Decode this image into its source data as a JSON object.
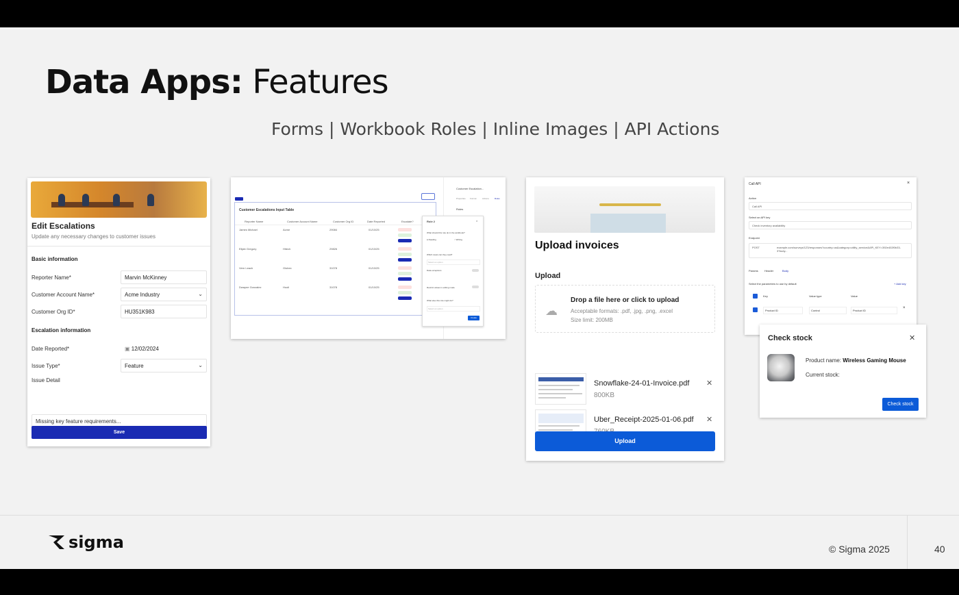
{
  "slide": {
    "title_bold": "Data Apps:",
    "title_light": "Features",
    "subtitle": "Forms | Workbook Roles | Inline Images | API Actions",
    "logo_text": "sigma",
    "copyright": "© Sigma 2025",
    "page_number": "40"
  },
  "form_card": {
    "title": "Edit Escalations",
    "subtitle": "Update any necessary changes to customer issues",
    "section_basic": "Basic information",
    "reporter_label": "Reporter Name*",
    "reporter_value": "Marvin McKinney",
    "account_label": "Customer Account Name*",
    "account_value": "Acme Industry",
    "org_label": "Customer Org ID*",
    "org_value": "HU351K983",
    "section_escalation": "Escalation information",
    "date_label": "Date Reported*",
    "date_value": "12/02/2024",
    "issue_type_label": "Issue Type*",
    "issue_type_value": "Feature",
    "issue_detail_label": "Issue Detail",
    "issue_detail_value": "Missing key feature requirements...",
    "save_label": "Save"
  },
  "table_card": {
    "table_title": "Customer Escalations Input Table",
    "columns": [
      "Reporter Name",
      "Customer Account Name",
      "Customer Org ID",
      "Date Reported",
      "Escalate?"
    ],
    "rows": [
      [
        "James Michael",
        "Acme",
        "29084",
        "01/10/25"
      ],
      [
        "Elijah Gregory",
        "Hitech",
        "29826",
        "01/10/25"
      ],
      [
        "Vern Leach",
        "Globex",
        "31078",
        "01/10/25"
      ],
      [
        "Dwayne Gonzalez",
        "Hooli",
        "31078",
        "01/10/25"
      ]
    ],
    "panel_title": "Role 2",
    "panel_items": [
      "What should this role do in the workbook?",
      "Reading",
      "Writing",
      "Which views can they read?",
      "Select an option",
      "Data exceptions",
      "Restrict values in editing mode",
      "What else this role might do?",
      "Select an option"
    ],
    "panel_button": "Create",
    "side_title": "Customer Escalation...",
    "side_tabs": [
      "Properties",
      "Format",
      "Actions",
      "Roles"
    ],
    "side_section": "Roles"
  },
  "upload_card": {
    "title": "Upload invoices",
    "section": "Upload",
    "drop_title": "Drop a file here or click to upload",
    "drop_formats": "Acceptable formats: .pdf, .jpg, .png, .excel",
    "drop_size": "Size limit: 200MB",
    "files": [
      {
        "name": "Snowflake-24-01-Invoice.pdf",
        "size": "800KB"
      },
      {
        "name": "Uber_Receipt-2025-01-06.pdf",
        "size": "760KB"
      }
    ],
    "upload_label": "Upload"
  },
  "api_card": {
    "title": "Call API",
    "action_label": "Action",
    "action_value": "Call API",
    "api_key_label": "Select an API key",
    "api_key_value": "Check inventory availability",
    "endpoint_label": "Endpoint",
    "method": "POST",
    "endpoint_value": "example.com/surveys/123/responses?country=us&category=utility_service&API_KEY=392e402f0b33-3*body...",
    "tabs": [
      "Params",
      "Header",
      "Body"
    ],
    "param_hint": "Select the parameters to use by default",
    "add_key": "+ Add key",
    "cols": [
      "Key",
      "Value type",
      "Value"
    ],
    "row": [
      "Product ID",
      "Control",
      "Product ID"
    ]
  },
  "stock_dialog": {
    "title": "Check stock",
    "product_label": "Product name:",
    "product_value": "Wireless Gaming Mouse",
    "stock_label": "Current stock:",
    "button": "Check stock"
  }
}
